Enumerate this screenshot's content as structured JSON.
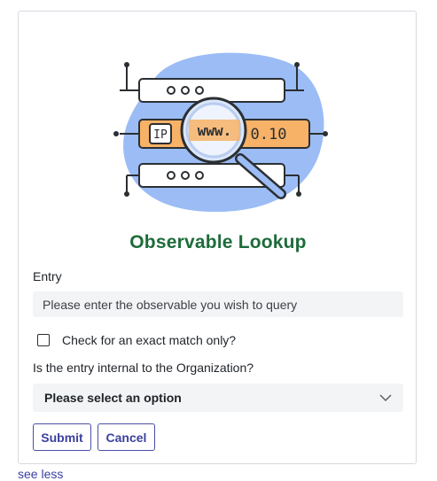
{
  "card": {
    "title": "Observable Lookup"
  },
  "illustration": {
    "ip_label": "IP",
    "www_label": "www.",
    "number_label": "0.10",
    "dots_top": "ooo",
    "dots_bottom": "ooo"
  },
  "form": {
    "entry_label": "Entry",
    "entry_placeholder": "Please enter the observable you wish to query",
    "entry_value": "",
    "exact_match_label": "Check for an exact match only?",
    "exact_match_checked": false,
    "internal_label": "Is the entry internal to the Organization?",
    "internal_selected": "Please select an option",
    "submit_label": "Submit",
    "cancel_label": "Cancel"
  },
  "footer": {
    "toggle_label": "see less"
  },
  "colors": {
    "title": "#1e6b3a",
    "accent": "#3b40a0",
    "blob": "#9bbcf5",
    "bar_orange": "#f7b267"
  }
}
